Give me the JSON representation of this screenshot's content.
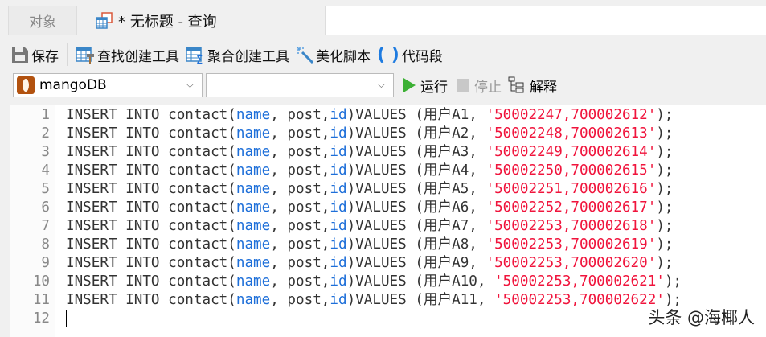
{
  "tabs": {
    "objects": "对象",
    "query": "* 无标题 - 查询"
  },
  "toolbar": {
    "save": "保存",
    "find_builder": "查找创建工具",
    "agg_builder": "聚合创建工具",
    "beautify": "美化脚本",
    "snippet": "代码段"
  },
  "connection": {
    "selected": "mangoDB",
    "database": ""
  },
  "actions": {
    "run": "运行",
    "stop": "停止",
    "explain": "解释"
  },
  "lines": [
    {
      "n": "1",
      "user": "用户A1",
      "val": "'50002247,700002612'"
    },
    {
      "n": "2",
      "user": "用户A2",
      "val": "'50002248,700002613'"
    },
    {
      "n": "3",
      "user": "用户A3",
      "val": "'50002249,700002614'"
    },
    {
      "n": "4",
      "user": "用户A4",
      "val": "'50002250,700002615'"
    },
    {
      "n": "5",
      "user": "用户A5",
      "val": "'50002251,700002616'"
    },
    {
      "n": "6",
      "user": "用户A6",
      "val": "'50002252,700002617'"
    },
    {
      "n": "7",
      "user": "用户A7",
      "val": "'50002253,700002618'"
    },
    {
      "n": "8",
      "user": "用户A8",
      "val": "'50002253,700002619'"
    },
    {
      "n": "9",
      "user": "用户A9",
      "val": "'50002253,700002620'"
    },
    {
      "n": "10",
      "user": "用户A10",
      "val": "'50002253,700002621'"
    },
    {
      "n": "11",
      "user": "用户A11",
      "val": "'50002253,700002622'"
    },
    {
      "n": "12"
    }
  ],
  "code_parts": {
    "p1": "INSERT INTO contact(",
    "name": "name",
    "p2": ", post,",
    "id": "id",
    "p3": ")VALUES (",
    "comma": ", ",
    "end": ");"
  },
  "watermark": "头条 @海椰人"
}
